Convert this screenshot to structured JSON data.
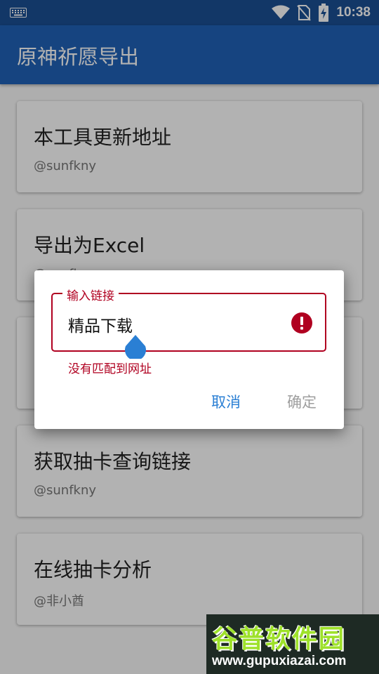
{
  "status_bar": {
    "time": "10:38",
    "icons": [
      "keyboard-icon",
      "wifi-icon",
      "no-sim-icon",
      "battery-charging-icon"
    ]
  },
  "app_bar": {
    "title": "原神祈愿导出"
  },
  "list": {
    "items": [
      {
        "title": "本工具更新地址",
        "subtitle": "@sunfkny"
      },
      {
        "title": "导出为Excel",
        "subtitle": "@sunfkny"
      },
      {
        "title": "",
        "subtitle": ""
      },
      {
        "title": "获取抽卡查询链接",
        "subtitle": "@sunfkny"
      },
      {
        "title": "在线抽卡分析",
        "subtitle": "@非小酋"
      }
    ]
  },
  "dialog": {
    "field_label": "输入链接",
    "field_value": "精品下载",
    "error_text": "没有匹配到网址",
    "cancel_label": "取消",
    "ok_label": "确定",
    "error_color": "#b00020",
    "accent_color": "#2a7fd4"
  },
  "watermark": {
    "brand": "谷普软件园",
    "url": "www.gupuxiazai.com"
  }
}
